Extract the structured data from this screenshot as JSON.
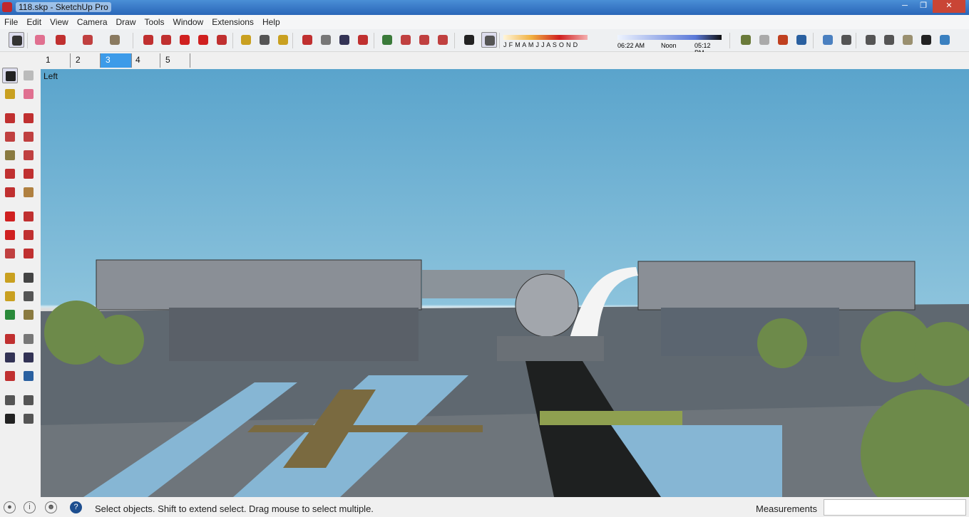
{
  "window": {
    "title": "118.skp - SketchUp Pro",
    "controls": [
      "minimize",
      "restore",
      "close"
    ]
  },
  "menu": [
    "File",
    "Edit",
    "View",
    "Camera",
    "Draw",
    "Tools",
    "Window",
    "Extensions",
    "Help"
  ],
  "toolbar": {
    "icons": [
      "select-icon",
      "eraser-icon",
      "pencil-icon",
      "arc-icon",
      "rectangle-icon",
      "push-pull-icon",
      "follow-me-icon",
      "move-icon",
      "rotate-icon",
      "scale-icon",
      "tape-measure-icon",
      "text-icon",
      "paint-bucket-icon",
      "orbit-icon",
      "pan-icon",
      "zoom-icon",
      "zoom-extents-icon",
      "3d-warehouse-icon",
      "share-model-icon",
      "components-icon",
      "send-to-layout-icon",
      "shadow-toggle-icon",
      "fog-icon",
      "add-location-icon",
      "toggle-terrain-icon",
      "walk-icon",
      "photo-textures-icon",
      "xray-icon",
      "back-edges-icon",
      "wireframe-icon",
      "hidden-line-icon",
      "shaded-icon",
      "shaded-textures-icon",
      "monochrome-icon"
    ]
  },
  "shadow": {
    "months": "J F M A M J J A S O N D",
    "time_start": "06:22 AM",
    "time_mid": "Noon",
    "time_end": "05:12 PM"
  },
  "scenes": [
    "1",
    "2",
    "3",
    "4",
    "5"
  ],
  "active_scene": "3",
  "left_toolbar": [
    "select-icon",
    "component-icon",
    "paint-bucket-icon",
    "eraser-icon",
    "line-icon",
    "freehand-icon",
    "rectangle-icon",
    "rotated-rectangle-icon",
    "circle-icon",
    "polygon-icon",
    "arc-icon",
    "two-point-arc-icon",
    "three-point-arc-icon",
    "pie-icon",
    "move-icon",
    "push-pull-icon",
    "rotate-icon",
    "follow-me-icon",
    "scale-icon",
    "offset-icon",
    "tape-measure-icon",
    "dimension-icon",
    "protractor-icon",
    "text-icon",
    "axes-icon",
    "3d-text-icon",
    "orbit-icon",
    "pan-icon",
    "zoom-icon",
    "zoom-window-icon",
    "zoom-extents-icon",
    "previous-view-icon",
    "position-camera-icon",
    "look-around-icon",
    "walk-icon",
    "section-plane-icon"
  ],
  "viewport": {
    "view_label": "Left"
  },
  "status": {
    "text": "Select objects. Shift to extend select. Drag mouse to select multiple.",
    "measurements_label": "Measurements",
    "measurements_value": ""
  }
}
